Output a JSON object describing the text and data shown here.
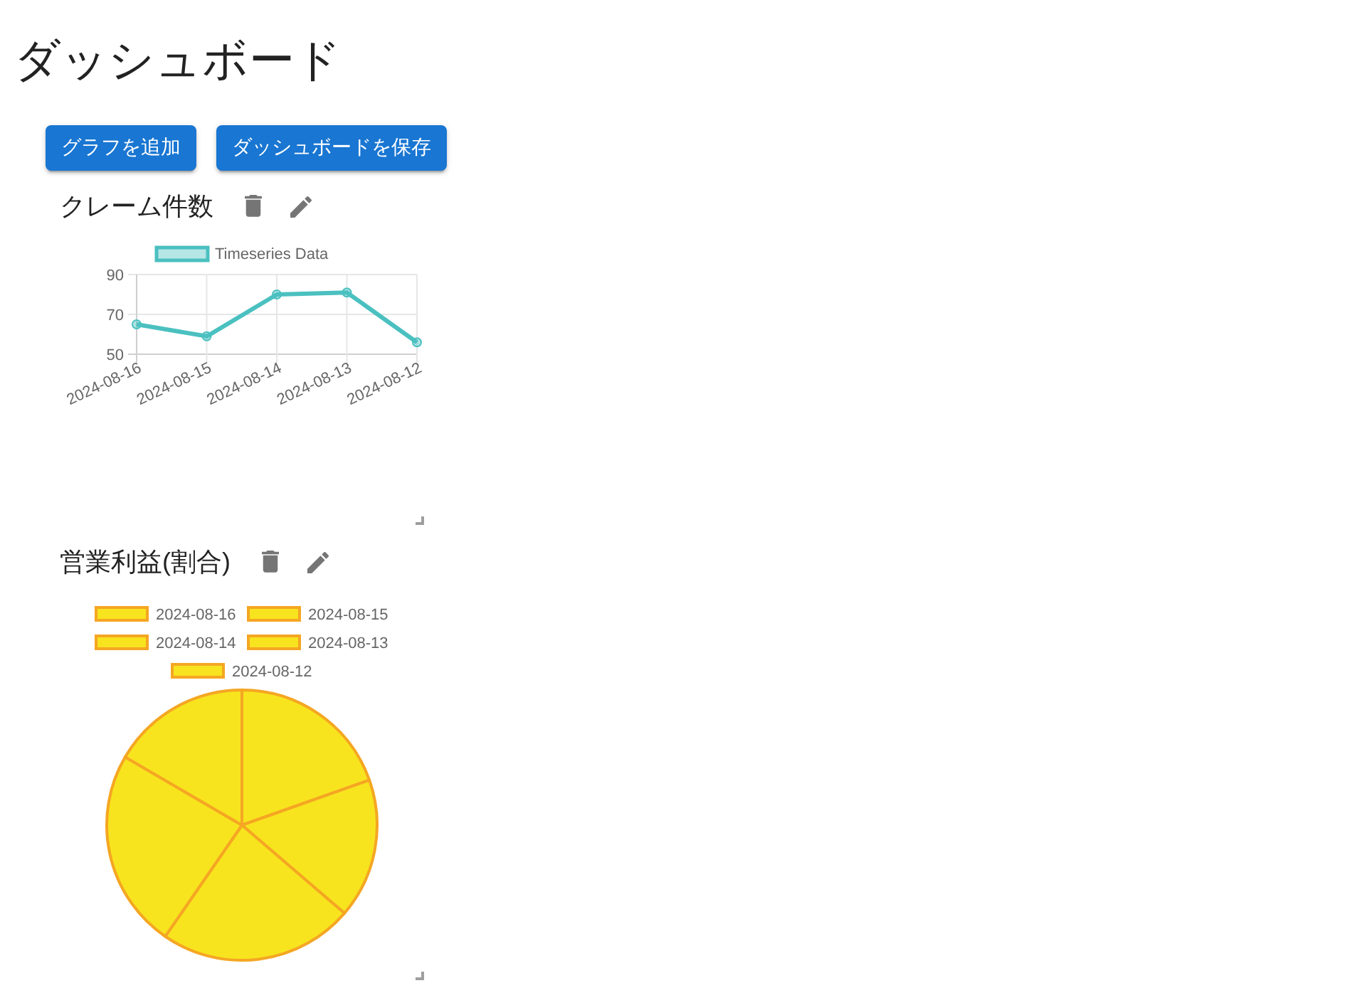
{
  "page": {
    "title": "ダッシュボード"
  },
  "buttons": [
    {
      "label": "グラフを追加"
    },
    {
      "label": "ダッシュボードを保存"
    }
  ],
  "cards": [
    {
      "title": "クレーム件数",
      "chart_data": {
        "type": "line",
        "legend": "top",
        "grid": true,
        "categories": [
          "2024-08-16",
          "2024-08-15",
          "2024-08-14",
          "2024-08-13",
          "2024-08-12"
        ],
        "series": [
          {
            "name": "Timeseries Data",
            "color": "#4bc0c0",
            "marker": true,
            "values": [
              65,
              59,
              80,
              81,
              56
            ]
          }
        ],
        "ylim": [
          50,
          90
        ],
        "yticks": [
          50,
          70,
          90
        ]
      }
    },
    {
      "title": "営業利益(割合)",
      "chart_data": {
        "type": "pie",
        "legend": "top",
        "categories": [
          "2024-08-16",
          "2024-08-15",
          "2024-08-14",
          "2024-08-13",
          "2024-08-12"
        ],
        "series": [
          {
            "color": "#f7e41e",
            "values": [
              19.6,
              16.7,
              23.3,
              23.8,
              16.6
            ]
          }
        ]
      }
    }
  ]
}
